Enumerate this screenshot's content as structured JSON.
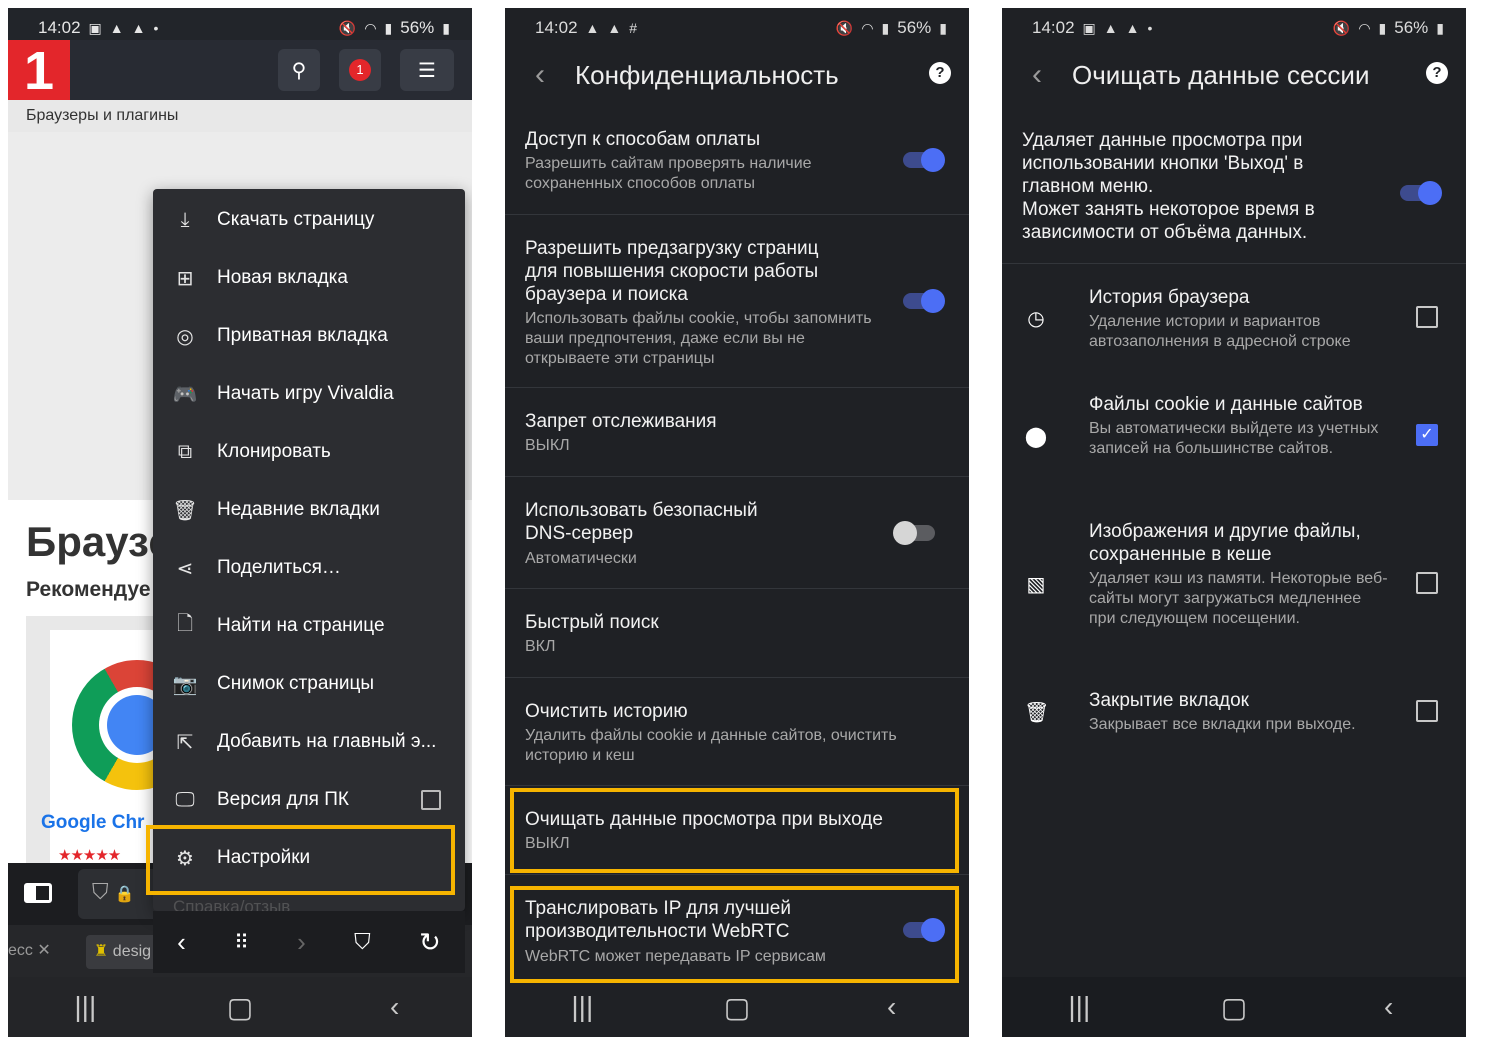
{
  "status_bar": {
    "time": "14:02",
    "battery": "56%",
    "icons_phone1": [
      "image-icon",
      "alert-icon",
      "alert-icon",
      "dot-icon"
    ],
    "icons_phone2": [
      "alert-icon",
      "alert-icon",
      "grid-icon"
    ],
    "icons_right": [
      "mute-icon",
      "wifi-icon",
      "signal-icon",
      "battery-icon"
    ]
  },
  "phone1": {
    "logo": "1",
    "notification_badge": "1",
    "breadcrumb": "Браузеры и плагины",
    "page_heading": "Браузе",
    "page_subheading": "Рекомендуе",
    "card_title": "Google Chr",
    "tab_left": "ecc",
    "tab_title": "desig",
    "menu": {
      "items": [
        {
          "label": "Скачать страницу",
          "icon": "download-icon"
        },
        {
          "label": "Новая вкладка",
          "icon": "new-tab-icon"
        },
        {
          "label": "Приватная вкладка",
          "icon": "fingerprint-icon"
        },
        {
          "label": "Начать игру Vivaldia",
          "icon": "gamepad-icon"
        },
        {
          "label": "Клонировать",
          "icon": "clone-icon"
        },
        {
          "label": "Недавние вкладки",
          "icon": "trash-icon"
        },
        {
          "label": "Поделиться…",
          "icon": "share-icon"
        },
        {
          "label": "Найти на странице",
          "icon": "find-in-page-icon"
        },
        {
          "label": "Снимок страницы",
          "icon": "camera-icon"
        },
        {
          "label": "Добавить на главный э...",
          "icon": "add-to-home-icon"
        },
        {
          "label": "Версия для ПК",
          "icon": "desktop-icon",
          "checkbox": false
        },
        {
          "label": "Настройки",
          "icon": "gear-icon"
        }
      ],
      "peek_label": "Справка/отзыв"
    }
  },
  "phone2": {
    "title": "Конфиденциальность",
    "settings": [
      {
        "title": "Доступ к способам оплаты",
        "subtitle": "Разрешить сайтам проверять наличие сохраненных способов оплаты",
        "toggle": true
      },
      {
        "title": "Разрешить предзагрузку страниц для повышения скорости работы браузера и поиска",
        "subtitle": "Использовать файлы cookie, чтобы запомнить ваши предпочтения, даже если вы не открываете эти страницы",
        "toggle": true
      },
      {
        "title": "Запрет отслеживания",
        "subtitle": "ВЫКЛ"
      },
      {
        "title": "Использовать безопасный DNS-сервер",
        "subtitle": "Автоматически",
        "toggle": false
      },
      {
        "title": "Быстрый поиск",
        "subtitle": "ВКЛ"
      },
      {
        "title": "Очистить историю",
        "subtitle": "Удалить файлы cookie и данные сайтов, очистить историю и кеш"
      },
      {
        "title": "Очищать данные просмотра при выходе",
        "subtitle": "ВЫКЛ"
      },
      {
        "title": "Транслировать IP для лучшей производительности WebRTC",
        "subtitle": "WebRTC может передавать IP сервисам",
        "toggle": true
      }
    ]
  },
  "phone3": {
    "title": "Очищать данные сессии",
    "intro": "Удаляет данные просмотра при использовании кнопки 'Выход' в главном меню.\nМожет занять некоторое время в зависимости от объёма данных.",
    "intro_toggle": true,
    "items": [
      {
        "title": "История браузера",
        "subtitle": "Удаление истории и вариантов автозаполнения в адресной строке",
        "icon": "clock-icon",
        "checked": false
      },
      {
        "title": "Файлы cookie и данные сайтов",
        "subtitle": "Вы автоматически выйдете из учетных записей на большинстве сайтов.",
        "icon": "cookie-icon",
        "checked": true
      },
      {
        "title": "Изображения и другие файлы, сохраненные в кеше",
        "subtitle": "Удаляет кэш из памяти. Некоторые веб-сайты могут загружаться медленнее при следующем посещении.",
        "icon": "image-icon",
        "checked": false
      },
      {
        "title": "Закрытие вкладок",
        "subtitle": "Закрывает все вкладки при выходе.",
        "icon": "close-tabs-icon",
        "checked": false
      }
    ]
  },
  "colors": {
    "accent": "#4c6ef5",
    "highlight": "#f6b400",
    "brand_red": "#e3262b",
    "dark_bg": "#1f2125"
  }
}
